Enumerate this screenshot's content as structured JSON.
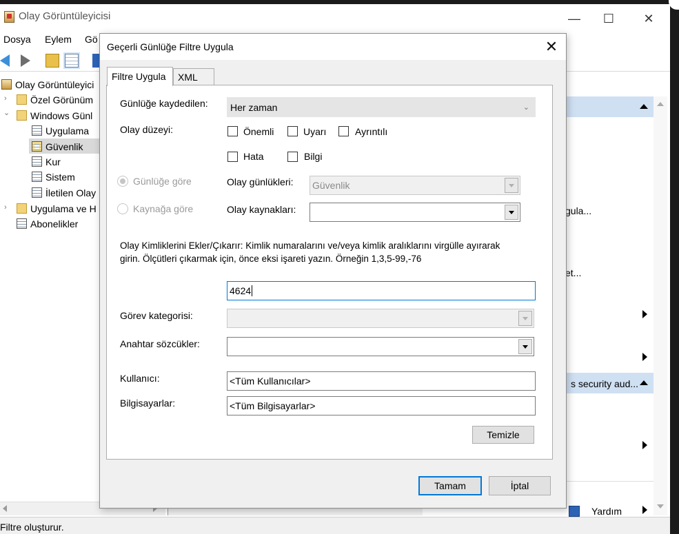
{
  "window": {
    "title": "Olay Görüntüleyicisi",
    "minimize": "—",
    "maximize": "☐",
    "close": "✕"
  },
  "menu": {
    "items": [
      "Dosya",
      "Eylem",
      "Gö"
    ]
  },
  "tree": {
    "items": [
      {
        "label": "Olay Görüntüleyici"
      },
      {
        "label": "Özel Görünüm"
      },
      {
        "label": "Windows Günl"
      },
      {
        "label": "Uygulama"
      },
      {
        "label": "Güvenlik"
      },
      {
        "label": "Kur"
      },
      {
        "label": "Sistem"
      },
      {
        "label": "İletilen Olay"
      },
      {
        "label": "Uygulama ve H"
      },
      {
        "label": "Abonelikler"
      }
    ],
    "expander_collapsed": "›",
    "expander_expanded": "⌄"
  },
  "actions_pane": {
    "items": [
      "gula...",
      "et...",
      "s security aud...",
      "Yardım"
    ]
  },
  "status_bar": {
    "text": "Filtre oluşturur."
  },
  "dialog": {
    "title": "Geçerli Günlüğe Filtre Uygula",
    "close": "✕",
    "tabs": [
      "Filtre Uygula",
      "XML"
    ],
    "logged_label": "Günlüğe kaydedilen:",
    "logged_value": "Her zaman",
    "level_label": "Olay düzeyi:",
    "levels": [
      "Önemli",
      "Uyarı",
      "Ayrıntılı",
      "Hata",
      "Bilgi"
    ],
    "by_log_label": "Günlüğe göre",
    "by_source_label": "Kaynağa göre",
    "event_logs_label": "Olay günlükleri:",
    "event_logs_value": "Güvenlik",
    "event_sources_label": "Olay kaynakları:",
    "event_sources_value": "",
    "ids_description_line1": "Olay Kimliklerini Ekler/Çıkarır: Kimlik numaralarını ve/veya kimlik aralıklarını virgülle ayırarak",
    "ids_description_line2": "girin. Ölçütleri çıkarmak için, önce eksi işareti yazın. Örneğin 1,3,5-99,-76",
    "ids_value": "4624",
    "task_category_label": "Görev kategorisi:",
    "task_category_value": "",
    "keywords_label": "Anahtar sözcükler:",
    "keywords_value": "",
    "user_label": "Kullanıcı:",
    "user_value": "<Tüm Kullanıcılar>",
    "computers_label": "Bilgisayarlar:",
    "computers_value": "<Tüm Bilgisayarlar>",
    "clear_button": "Temizle",
    "ok_button": "Tamam",
    "cancel_button": "İptal"
  },
  "colors": {
    "accent": "#0078d7",
    "selection_blue": "#cfe0f3",
    "tree_selection": "#d9d9d9",
    "dialog_bg": "#f0f0f0"
  }
}
